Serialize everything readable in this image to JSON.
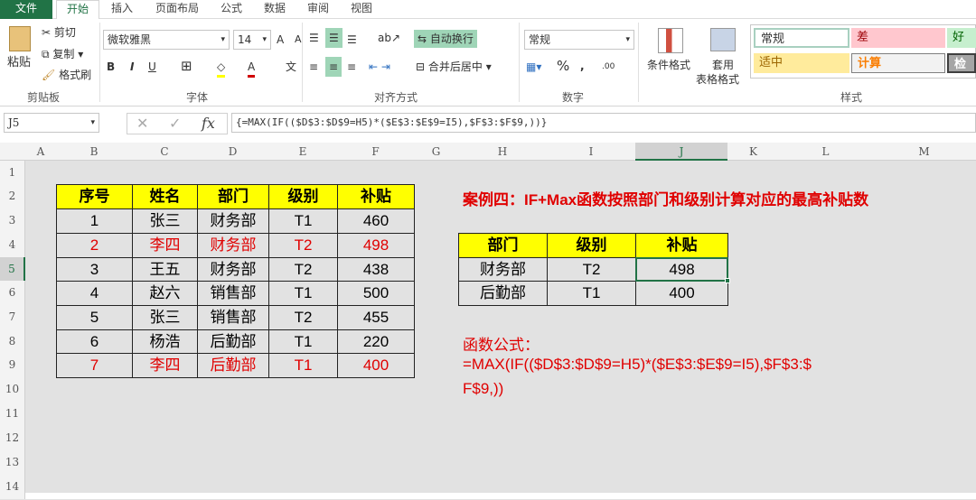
{
  "tabs": [
    "文件",
    "开始",
    "插入",
    "页面布局",
    "公式",
    "数据",
    "审阅",
    "视图"
  ],
  "ribbon": {
    "clipboard": {
      "paste": "粘贴",
      "cut": "剪切",
      "copy": "复制",
      "format_painter": "格式刷",
      "label": "剪贴板"
    },
    "font": {
      "name": "微软雅黑",
      "size": "14",
      "bold": "B",
      "italic": "I",
      "underline": "U",
      "grow": "A",
      "shrink": "A",
      "font_color": "A",
      "phonetic": "文",
      "label": "字体"
    },
    "alignment": {
      "wrap": "自动换行",
      "merge": "合并后居中",
      "label": "对齐方式"
    },
    "number": {
      "format": "常规",
      "percent": "%",
      "comma": ",",
      "inc_dec": ".00",
      "label": "数字"
    },
    "styles": {
      "conditional": "条件格式",
      "table_format_1": "套用",
      "table_format_2": "表格格式",
      "normal": "常规",
      "bad": "差",
      "good": "好",
      "neutral": "适中",
      "calculation": "计算",
      "check": "检查",
      "label": "样式"
    }
  },
  "formula_bar": {
    "name_box": "J5",
    "formula": "{=MAX(IF(($D$3:$D$9=H5)*($E$3:$E$9=I5),$F$3:$F$9,))}"
  },
  "columns": [
    "A",
    "B",
    "C",
    "D",
    "E",
    "F",
    "G",
    "H",
    "I",
    "J",
    "K",
    "L",
    "M"
  ],
  "rows": [
    "1",
    "2",
    "3",
    "4",
    "5",
    "6",
    "7",
    "8",
    "9",
    "10",
    "11",
    "12",
    "13",
    "14"
  ],
  "selected_cell": "J5",
  "table1": {
    "headers": [
      "序号",
      "姓名",
      "部门",
      "级别",
      "补贴"
    ],
    "rows": [
      {
        "values": [
          "1",
          "张三",
          "财务部",
          "T1",
          "460"
        ],
        "highlight": false
      },
      {
        "values": [
          "2",
          "李四",
          "财务部",
          "T2",
          "498"
        ],
        "highlight": true
      },
      {
        "values": [
          "3",
          "王五",
          "财务部",
          "T2",
          "438"
        ],
        "highlight": false
      },
      {
        "values": [
          "4",
          "赵六",
          "销售部",
          "T1",
          "500"
        ],
        "highlight": false
      },
      {
        "values": [
          "5",
          "张三",
          "销售部",
          "T2",
          "455"
        ],
        "highlight": false
      },
      {
        "values": [
          "6",
          "杨浩",
          "后勤部",
          "T1",
          "220"
        ],
        "highlight": false
      },
      {
        "values": [
          "7",
          "李四",
          "后勤部",
          "T1",
          "400"
        ],
        "highlight": true
      }
    ]
  },
  "title": "案例四：IF+Max函数按照部门和级别计算对应的最高补贴数",
  "table2": {
    "headers": [
      "部门",
      "级别",
      "补贴"
    ],
    "rows": [
      [
        "财务部",
        "T2",
        "498"
      ],
      [
        "后勤部",
        "T1",
        "400"
      ]
    ]
  },
  "notes": {
    "label": "函数公式：",
    "line1": "=MAX(IF(($D$3:$D$9=H5)*($E$3:$E$9=I5),$F$3:$",
    "line2": "F$9,))"
  },
  "colors": {
    "accent": "#217346",
    "header_fill": "#ffff00",
    "highlight_text": "#e00000"
  }
}
